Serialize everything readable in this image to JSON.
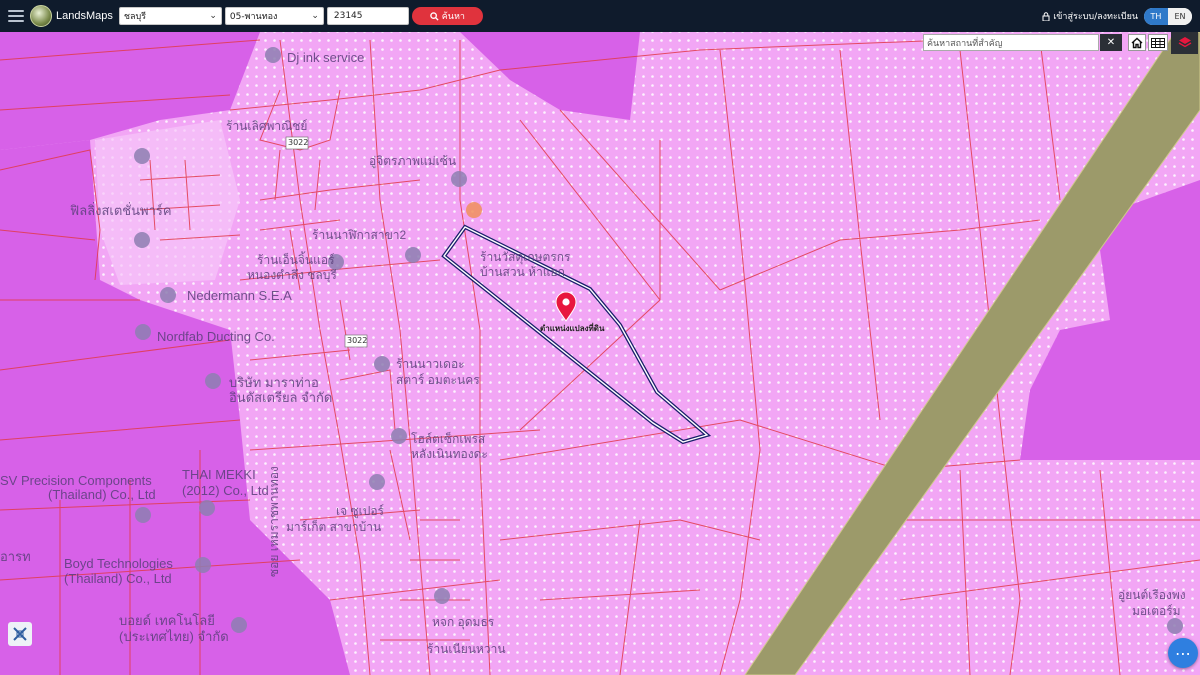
{
  "header": {
    "brand": "LandsMaps",
    "province": "ชลบุรี",
    "district": "05-พานทอง",
    "parcel_no": "23145",
    "search_label": "ค้นหา",
    "login_label": "เข้าสู่ระบบ/ลงทะเบียน",
    "lang_th": "TH",
    "lang_en": "EN"
  },
  "map_search": {
    "placeholder": "ค้นหาสถานที่สำคัญ",
    "clear": "✕"
  },
  "pin_label": "ตำแหน่งแปลงที่ดิน",
  "places": [
    {
      "id": "p1",
      "text": "Dj ink service"
    },
    {
      "id": "p2",
      "text": "ฟิลลิ่งสเตชั่นพาร์ค"
    },
    {
      "id": "p3",
      "text": "Nedermann S.E.A"
    },
    {
      "id": "p4",
      "text": "Nordfab Ducting Co."
    },
    {
      "id": "p5",
      "text": "บริษัท มาราท่าอ"
    },
    {
      "id": "p6",
      "text": "อินดัสเตรียล จำกัด"
    },
    {
      "id": "p7",
      "text": "SV Precision Components"
    },
    {
      "id": "p8",
      "text": "(Thailand) Co., Ltd"
    },
    {
      "id": "p9",
      "text": "THAI MEKKI"
    },
    {
      "id": "p10",
      "text": "(2012) Co., Ltd"
    },
    {
      "id": "p11",
      "text": "Boyd Technologies"
    },
    {
      "id": "p12",
      "text": "(Thailand) Co., Ltd"
    },
    {
      "id": "p13",
      "text": "บอยด์ เทคโนโลยี"
    },
    {
      "id": "p14",
      "text": "(ประเทศไทย) จำกัด"
    },
    {
      "id": "p15",
      "text": "อารท"
    },
    {
      "id": "p16",
      "text": "ร้านเลิศพาณิชย์"
    },
    {
      "id": "p17",
      "text": "อู่จิตรภาพแม่เซ้น"
    },
    {
      "id": "p18",
      "text": "ร้านนาฬิกาสาขา2"
    },
    {
      "id": "p19",
      "text": "ร้านเอ็นจิ้นแอร์"
    },
    {
      "id": "p20",
      "text": "หนองตำลึง ชลบุรี"
    },
    {
      "id": "p21",
      "text": "ร้านนาวเดอะ"
    },
    {
      "id": "p22",
      "text": "สตาร์ อมตะนคร"
    },
    {
      "id": "p23",
      "text": "โฮล์ตเซ็กเพรส"
    },
    {
      "id": "p24",
      "text": "หลังเนินทองดะ"
    },
    {
      "id": "p25",
      "text": "เจ ซูเปอร์"
    },
    {
      "id": "p26",
      "text": "มาร์เก็ต สาขาบ้าน"
    },
    {
      "id": "p27",
      "text": "ร้านวัสดุเกษตรกร"
    },
    {
      "id": "p28",
      "text": "บ้านสวน ห้าแยก"
    },
    {
      "id": "p29",
      "text": "หจก อุดมธร"
    },
    {
      "id": "p30",
      "text": "ร้านเนียนหวาน"
    },
    {
      "id": "p31",
      "text": "อู่ยนต์เรืองพง"
    },
    {
      "id": "p32",
      "text": "มอเตอร์ม"
    },
    {
      "id": "p33",
      "text": "ซอย เหมราชพานทอง"
    },
    {
      "id": "p34",
      "text": "3022"
    },
    {
      "id": "p35",
      "text": "3022"
    }
  ],
  "colors": {
    "topbar": "#0f1b2c",
    "zone_pink": "#f2a6f5",
    "zone_magenta": "#d761e8",
    "parcel_line": "#e23a4a",
    "railway": "#9c9a6a",
    "selected_parcel": "#1a1f6b",
    "pin": "#e8173e",
    "search_button": "#e0333d",
    "lang_active": "#2f79c9"
  },
  "icons": {
    "menu": "hamburger-icon",
    "search": "search-icon",
    "lock": "lock-icon",
    "home": "home-icon",
    "grid": "grid-icon",
    "layers": "layers-icon",
    "tool": "ruler-icon",
    "more": "more-icon"
  }
}
